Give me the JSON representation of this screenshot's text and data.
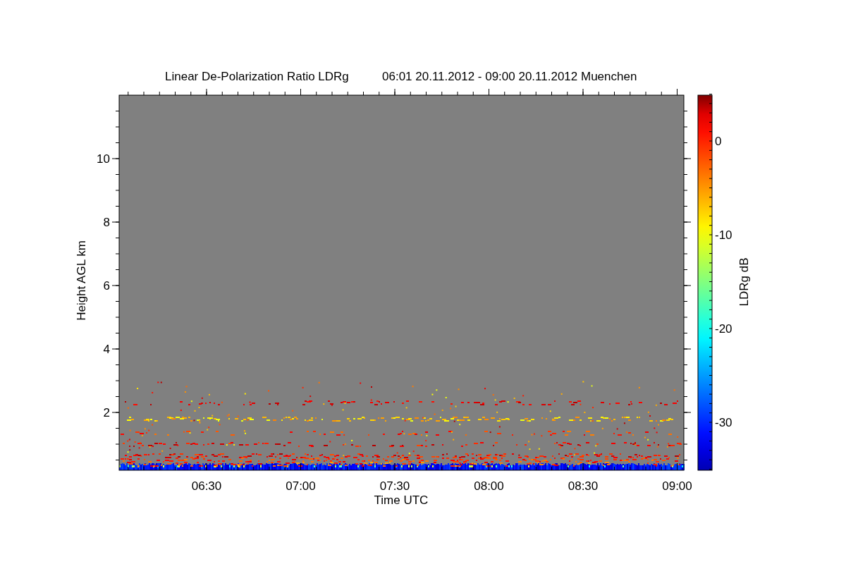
{
  "plot": {
    "title_parts": [
      "Linear De-Polarization Ratio LDRg",
      "06:01 20.11.2012 - 09:00 20.11.2012 Muenchen"
    ],
    "y_axis": {
      "label": "Height AGL km",
      "ticks": [
        "10",
        "8",
        "6",
        "4",
        "2"
      ]
    },
    "x_axis": {
      "label": "Time UTC",
      "ticks": [
        "06:30",
        "07:00",
        "07:30",
        "08:00",
        "08:30",
        "09:00"
      ]
    },
    "colorbar": {
      "label": "LDRg dB",
      "ticks": [
        "0",
        "-10",
        "-20",
        "-30"
      ]
    }
  }
}
